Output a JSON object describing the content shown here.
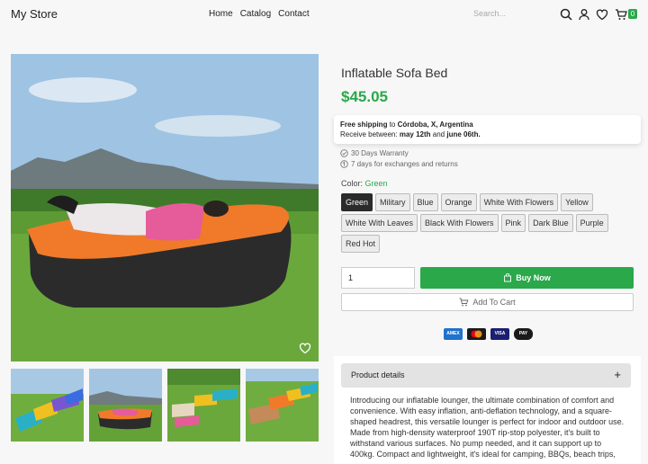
{
  "header": {
    "brand": "My Store",
    "nav": [
      "Home",
      "Catalog",
      "Contact"
    ],
    "search_placeholder": "Search...",
    "cart_count": "0"
  },
  "product": {
    "title": "Inflatable Sofa Bed",
    "price": "$45.05",
    "shipping": {
      "prefix": "Free shipping",
      "to": "to",
      "destination": "Córdoba, X, Argentina",
      "receive_label": "Receive between:",
      "date_from": "may 12th",
      "and": "and",
      "date_to": "june 06th."
    },
    "warranty": "30 Days Warranty",
    "returns": "7 days for exchanges and returns",
    "color_label": "Color:",
    "selected_color": "Green",
    "colors": [
      "Green",
      "Military",
      "Blue",
      "Orange",
      "White With Flowers",
      "Yellow",
      "White With Leaves",
      "Black With Flowers",
      "Pink",
      "Dark Blue",
      "Purple",
      "Red Hot"
    ],
    "quantity": "1",
    "buy_now": "Buy Now",
    "add_to_cart": "Add To Cart",
    "payment": [
      "AMEX",
      "MC",
      "VISA",
      "PAY"
    ],
    "details_title": "Product details",
    "details_toggle": "+",
    "description": "Introducing our inflatable lounger, the ultimate combination of comfort and convenience. With easy inflation, anti-deflation technology, and a square-shaped headrest, this versatile lounger is perfect for indoor and outdoor use. Made from high-density waterproof 190T rip-stop polyester, it's built to withstand various surfaces. No pump needed, and it can support up to 400kg. Compact and lightweight, it's ideal for camping, BBQs, beach trips,"
  },
  "colors": {
    "accent": "#2aa84a",
    "selected_swatch": "#2b2b2b"
  }
}
